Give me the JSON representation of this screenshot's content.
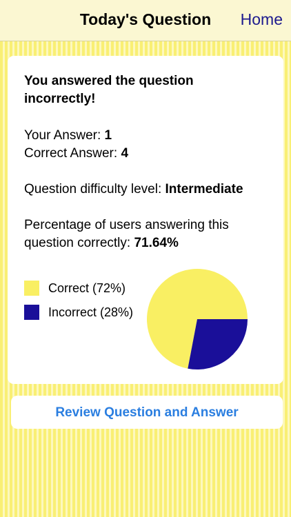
{
  "nav": {
    "title": "Today's Question",
    "home_label": "Home"
  },
  "result": {
    "headline": "You answered the question incorrectly!",
    "your_answer_label": "Your Answer: ",
    "your_answer_value": "1",
    "correct_answer_label": "Correct Answer: ",
    "correct_answer_value": "4",
    "difficulty_label": "Question difficulty level: ",
    "difficulty_value": "Intermediate",
    "percentage_label": "Percentage of users answering this question correctly: ",
    "percentage_value": "71.64%"
  },
  "legend": [
    {
      "label": "Correct (72%)",
      "color": "#f9ef63"
    },
    {
      "label": "Incorrect (28%)",
      "color": "#1a0f99"
    }
  ],
  "pie": {
    "correct_fraction": 0.72,
    "incorrect_fraction": 0.28,
    "correct_color": "#f9ef63",
    "incorrect_color": "#1a0f99"
  },
  "review_button_label": "Review Question and Answer"
}
